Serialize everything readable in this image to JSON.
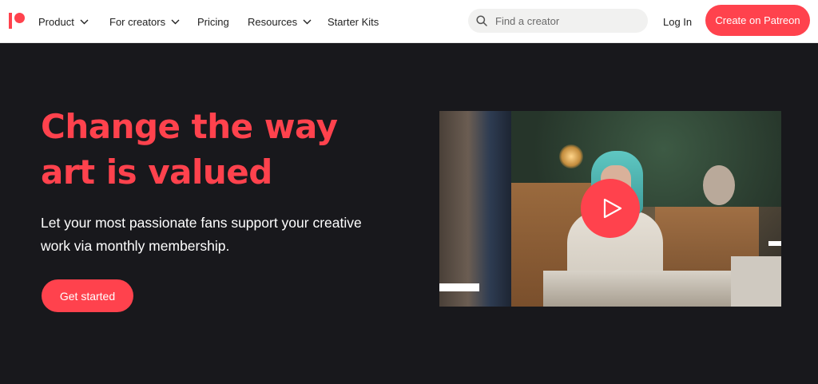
{
  "nav": {
    "logo": "patreon-logo",
    "items": [
      {
        "label": "Product",
        "has_dropdown": true
      },
      {
        "label": "For creators",
        "has_dropdown": true
      },
      {
        "label": "Pricing",
        "has_dropdown": false
      },
      {
        "label": "Resources",
        "has_dropdown": true
      },
      {
        "label": "Starter Kits",
        "has_dropdown": false
      }
    ],
    "search_placeholder": "Find a creator",
    "search_icon": "search-icon",
    "login_label": "Log In",
    "cta_label": "Create on Patreon"
  },
  "hero": {
    "title": "Change the way art is valued",
    "subtitle": "Let your most passionate fans support your creative work via monthly membership.",
    "button_label": "Get started"
  },
  "video": {
    "play_icon": "play-icon"
  },
  "colors": {
    "brand": "#ff424d",
    "hero_background": "#18181c",
    "nav_background": "#ffffff"
  }
}
